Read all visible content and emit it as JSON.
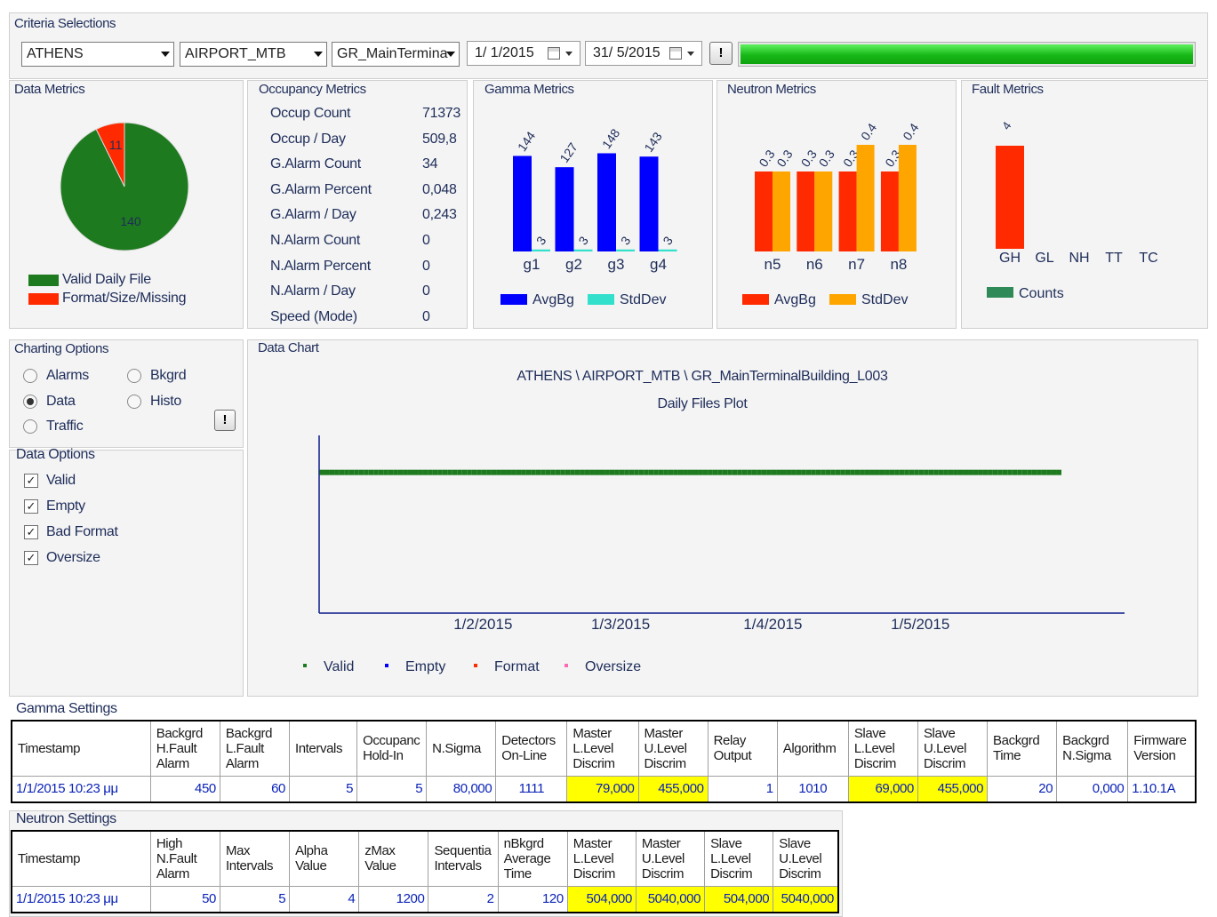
{
  "criteria": {
    "label": "Criteria Selections",
    "city": "ATHENS",
    "site": "AIRPORT_MTB",
    "lane": "GR_MainTermina",
    "start_date": "1/ 1/2015",
    "end_date": "31/ 5/2015",
    "go_button": "!",
    "progress_fraction": 1.0
  },
  "colors": {
    "valid_green": "#1e7a1e",
    "format_red": "#ff2a00",
    "avgbg_blue": "#0000ff",
    "stddev_cyan": "#33e0cc",
    "avgbg_red": "#ff2a00",
    "stddev_orange": "#ffa500",
    "counts_green": "#2e8b57",
    "empty_blue": "#0000ff",
    "oversize_pink": "#ff69b4",
    "highlight_yellow": "#ffff00"
  },
  "data_metrics": {
    "label": "Data Metrics",
    "legend": [
      "Valid Daily File",
      "Format/Size/Missing"
    ]
  },
  "occupancy_metrics": {
    "label": "Occupancy Metrics",
    "rows": [
      {
        "name": "Occup Count",
        "value": "71373"
      },
      {
        "name": "Occup / Day",
        "value": "509,8"
      },
      {
        "name": "G.Alarm Count",
        "value": "34"
      },
      {
        "name": "G.Alarm Percent",
        "value": "0,048"
      },
      {
        "name": "G.Alarm / Day",
        "value": "0,243"
      },
      {
        "name": "N.Alarm Count",
        "value": "0"
      },
      {
        "name": "N.Alarm Percent",
        "value": "0"
      },
      {
        "name": "N.Alarm / Day",
        "value": "0"
      },
      {
        "name": "Speed (Mode)",
        "value": "0"
      }
    ]
  },
  "gamma_metrics": {
    "label": "Gamma Metrics"
  },
  "neutron_metrics": {
    "label": "Neutron Metrics"
  },
  "fault_metrics": {
    "label": "Fault Metrics"
  },
  "charting_options": {
    "label": "Charting Options",
    "radios": [
      {
        "label": "Alarms",
        "checked": false
      },
      {
        "label": "Bkgrd",
        "checked": false
      },
      {
        "label": "Data",
        "checked": true
      },
      {
        "label": "Histo",
        "checked": false
      },
      {
        "label": "Traffic",
        "checked": false
      }
    ],
    "apply_button": "!"
  },
  "data_options": {
    "label": "Data Options",
    "checks": [
      {
        "label": "Valid",
        "checked": true
      },
      {
        "label": "Empty",
        "checked": true
      },
      {
        "label": "Bad Format",
        "checked": true
      },
      {
        "label": "Oversize",
        "checked": true
      }
    ]
  },
  "data_chart": {
    "label": "Data Chart",
    "title": "ATHENS \\ AIRPORT_MTB \\ GR_MainTerminalBuilding_L003",
    "subtitle": "Daily Files Plot"
  },
  "chart_data": [
    {
      "type": "pie",
      "labels": [
        "Valid Daily File",
        "Format/Size/Missing"
      ],
      "values": [
        140,
        11
      ],
      "colors": [
        "#1e7a1e",
        "#ff2a00"
      ],
      "legend": "bottom-left"
    },
    {
      "type": "bar",
      "categories": [
        "g1",
        "g2",
        "g3",
        "g4"
      ],
      "series": [
        {
          "name": "AvgBg",
          "values": [
            144,
            127,
            148,
            143
          ],
          "color": "#0000ff"
        },
        {
          "name": "StdDev",
          "values": [
            3,
            3,
            3,
            3
          ],
          "color": "#33e0cc"
        }
      ],
      "ylim": [
        0,
        150
      ],
      "legend": "bottom"
    },
    {
      "type": "bar",
      "categories": [
        "n5",
        "n6",
        "n7",
        "n8"
      ],
      "series": [
        {
          "name": "AvgBg",
          "values": [
            0.3,
            0.3,
            0.3,
            0.3
          ],
          "color": "#ff2a00"
        },
        {
          "name": "StdDev",
          "values": [
            0.3,
            0.3,
            0.4,
            0.4
          ],
          "color": "#ffa500"
        }
      ],
      "ylim": [
        0,
        0.4
      ],
      "legend": "bottom"
    },
    {
      "type": "bar",
      "categories": [
        "GH",
        "GL",
        "NH",
        "TT",
        "TC"
      ],
      "series": [
        {
          "name": "Counts",
          "values": [
            4,
            0,
            0,
            0,
            0
          ],
          "color": "#2e8b57",
          "point_colors": [
            "#ff2a00",
            null,
            null,
            null,
            null
          ]
        }
      ],
      "ylim": [
        0,
        4
      ],
      "legend": "bottom"
    },
    {
      "type": "scatter",
      "title": "ATHENS \\ AIRPORT_MTB \\ GR_MainTerminalBuilding_L003",
      "subtitle": "Daily Files Plot",
      "xlim": [
        "2015-01-01",
        "2015-05-31"
      ],
      "xticks": [
        "1/2/2015",
        "1/3/2015",
        "1/4/2015",
        "1/5/2015"
      ],
      "ylim": [
        0,
        1.2
      ],
      "series": [
        {
          "name": "Valid",
          "color": "#1e7a1e",
          "x_start": "2015-01-01",
          "x_end": "2015-05-31",
          "y": 1
        },
        {
          "name": "Empty",
          "color": "#0000ff",
          "points": []
        },
        {
          "name": "Format",
          "color": "#ff2a00",
          "points": []
        },
        {
          "name": "Oversize",
          "color": "#ff69b4",
          "points": []
        }
      ],
      "legend": "bottom"
    }
  ],
  "gamma_settings": {
    "label": "Gamma Settings",
    "headers": [
      "Timestamp",
      "Backgrd\nH.Fault\nAlarm",
      "Backgrd\nL.Fault\nAlarm",
      "Intervals",
      "Occupanc\nHold-In",
      "N.Sigma",
      "Detectors\nOn-Line",
      "Master\nL.Level\nDiscrim",
      "Master\nU.Level\nDiscrim",
      "Relay\nOutput",
      "Algorithm",
      "Slave\nL.Level\nDiscrim",
      "Slave\nU.Level\nDiscrim",
      "Backgrd\nTime",
      "Backgrd\nN.Sigma",
      "Firmware\nVersion"
    ],
    "row": [
      "1/1/2015 10:23 μμ",
      "450",
      "60",
      "5",
      "5",
      "80,000",
      "1111",
      "79,000",
      "455,000",
      "1",
      "1010",
      "69,000",
      "455,000",
      "20",
      "0,000",
      "1.10.1A"
    ]
  },
  "neutron_settings": {
    "label": "Neutron Settings",
    "headers": [
      "Timestamp",
      "High\nN.Fault\nAlarm",
      "Max\nIntervals",
      "Alpha\nValue",
      "zMax\nValue",
      "Sequentia\nIntervals",
      "nBkgrd\nAverage\nTime",
      "Master\nL.Level\nDiscrim",
      "Master\nU.Level\nDiscrim",
      "Slave\nL.Level\nDiscrim",
      "Slave\nU.Level\nDiscrim"
    ],
    "row": [
      "1/1/2015 10:23 μμ",
      "50",
      "5",
      "4",
      "1200",
      "2",
      "120",
      "504,000",
      "5040,000",
      "504,000",
      "5040,000"
    ]
  }
}
